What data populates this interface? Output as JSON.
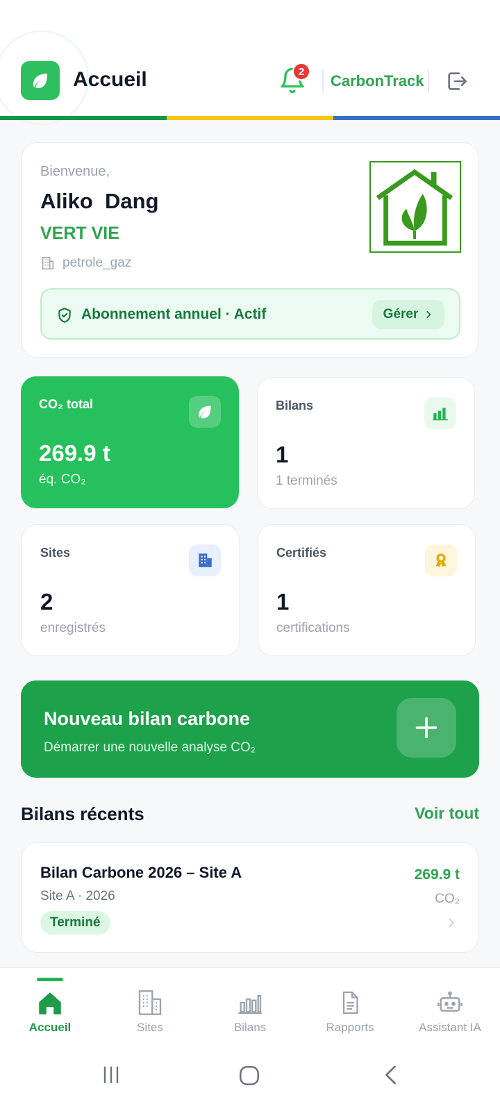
{
  "header": {
    "title": "Accueil",
    "notification_count": "2",
    "brand": "CarbonTrack",
    "colors": {
      "green": "#2ec05f",
      "accent_bar": [
        "#14964a",
        "#f5c518",
        "#3a70c4"
      ]
    }
  },
  "welcome": {
    "greeting": "Bienvenue,",
    "user_name": "Aliko  Dang",
    "company": "VERT VIE",
    "sector": "petrole_gaz",
    "subscription": "Abonnement annuel · Actif",
    "manage_label": "Gérer"
  },
  "stats": {
    "co2": {
      "label": "CO₂ total",
      "value": "269.9 t",
      "sub": "éq. CO₂"
    },
    "bilans": {
      "label": "Bilans",
      "value": "1",
      "sub": "1 terminés"
    },
    "sites": {
      "label": "Sites",
      "value": "2",
      "sub": "enregistrés"
    },
    "certified": {
      "label": "Certifiés",
      "value": "1",
      "sub": "certifications"
    }
  },
  "cta": {
    "title": "Nouveau bilan carbone",
    "subtitle": "Démarrer une nouvelle analyse CO₂"
  },
  "recent": {
    "title": "Bilans récents",
    "see_all": "Voir tout",
    "items": [
      {
        "title": "Bilan Carbone 2026 – Site A",
        "subtitle": "Site A · 2026",
        "status": "Terminé",
        "value": "269.9 t",
        "unit": "CO₂"
      }
    ]
  },
  "nav": {
    "items": [
      {
        "label": "Accueil",
        "icon": "home-icon",
        "active": true
      },
      {
        "label": "Sites",
        "icon": "building-icon"
      },
      {
        "label": "Bilans",
        "icon": "bar-chart-icon"
      },
      {
        "label": "Rapports",
        "icon": "document-icon"
      },
      {
        "label": "Assistant IA",
        "icon": "robot-icon"
      }
    ]
  }
}
